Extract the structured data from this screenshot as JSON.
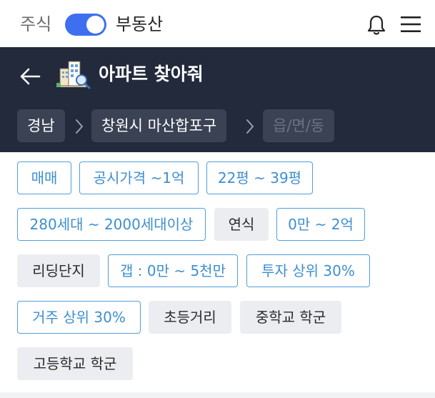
{
  "topbar": {
    "mode_left": "주식",
    "mode_right": "부동산",
    "toggle_on": true,
    "toggle_color": "#3d6ff0"
  },
  "header": {
    "title": "아파트 찾아줘",
    "icon": "apartment-search-icon",
    "background": "#222a3c"
  },
  "breadcrumb": {
    "items": [
      "경남",
      "창원시 마산합포구",
      "읍/면/동"
    ]
  },
  "filters": {
    "chips": [
      {
        "label": "매매",
        "selected": true
      },
      {
        "label": "공시가격 ~1억",
        "selected": true
      },
      {
        "label": "22평 ~ 39평",
        "selected": true
      },
      {
        "label": "280세대 ~ 2000세대이상",
        "selected": true
      },
      {
        "label": "연식",
        "selected": false
      },
      {
        "label": "0만 ~ 2억",
        "selected": true
      },
      {
        "label": "리딩단지",
        "selected": false
      },
      {
        "label": "갭 : 0만 ~ 5천만",
        "selected": true
      },
      {
        "label": "투자 상위 30%",
        "selected": true
      },
      {
        "label": "거주 상위 30%",
        "selected": true
      },
      {
        "label": "초등거리",
        "selected": false
      },
      {
        "label": "중학교 학군",
        "selected": false
      },
      {
        "label": "고등학교 학군",
        "selected": false
      }
    ],
    "selected_color": "#3d8fd0",
    "unselected_bg": "#ebedf0"
  }
}
